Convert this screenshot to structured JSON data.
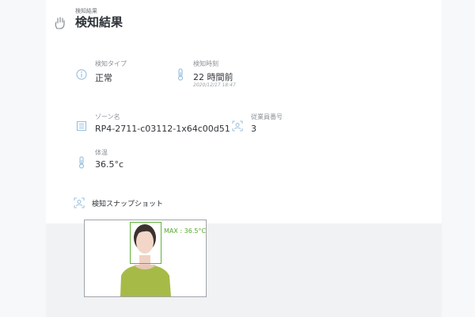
{
  "header": {
    "breadcrumb": "検知結果",
    "title": "検知結果"
  },
  "fields": {
    "detection_type": {
      "label": "検知タイプ",
      "value": "正常"
    },
    "detection_time": {
      "label": "検知時刻",
      "value": "22 時間前",
      "timestamp": "2020/12/17 18:47"
    },
    "zone_name": {
      "label": "ゾーン名",
      "value": "RP4-2711-c03112-1x64c00d51"
    },
    "employee_number": {
      "label": "従業員番号",
      "value": "3"
    },
    "body_temperature": {
      "label": "体温",
      "value": "36.5°c"
    }
  },
  "snapshot": {
    "label": "検知スナップショット",
    "detection_label": "MAX : 36.5°C"
  },
  "colors": {
    "accent_green": "#57a82e",
    "icon_blue": "#9cc3e0"
  }
}
